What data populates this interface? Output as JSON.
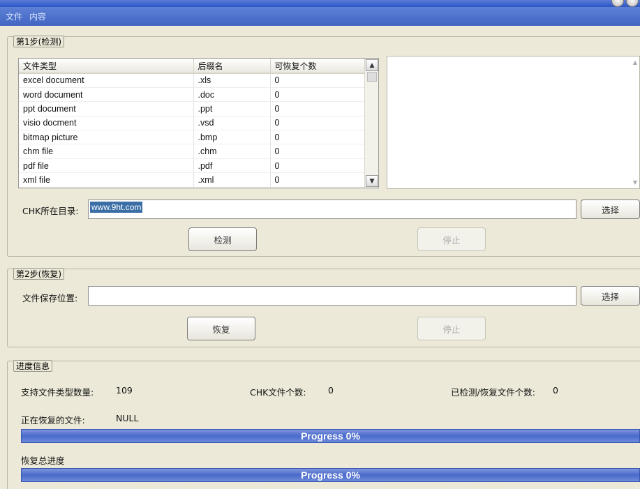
{
  "menu": [
    "文件",
    "内容"
  ],
  "step1": {
    "title": "第1步(检测)",
    "columns": [
      "文件类型",
      "后缀名",
      "可恢复个数"
    ],
    "rows": [
      [
        "excel document",
        ".xls",
        "0"
      ],
      [
        "word document",
        ".doc",
        "0"
      ],
      [
        "ppt document",
        ".ppt",
        "0"
      ],
      [
        "visio docment",
        ".vsd",
        "0"
      ],
      [
        "bitmap picture",
        ".bmp",
        "0"
      ],
      [
        "chm file",
        ".chm",
        "0"
      ],
      [
        "pdf file",
        ".pdf",
        "0"
      ],
      [
        "xml file",
        ".xml",
        "0"
      ]
    ],
    "dir_label": "CHK所在目录:",
    "dir_value": "www.9ht.com",
    "browse_label": "选择",
    "detect_label": "检测",
    "stop_label": "停止"
  },
  "step2": {
    "title": "第2步(恢复)",
    "save_label": "文件保存位置:",
    "save_value": "",
    "browse_label": "选择",
    "recover_label": "恢复",
    "stop_label": "停止"
  },
  "progress": {
    "title": "进度信息",
    "types_label": "支持文件类型数量:",
    "types_value": "109",
    "chk_label": "CHK文件个数:",
    "chk_value": "0",
    "done_label": "已检测/恢复文件个数:",
    "done_value": "0",
    "current_label": "正在恢复的文件:",
    "current_value": "NULL",
    "bar1_text": "Progress 0%",
    "bar1_percent": 0,
    "total_label": "恢复总进度",
    "bar2_text": "Progress 0%",
    "bar2_percent": 0
  }
}
